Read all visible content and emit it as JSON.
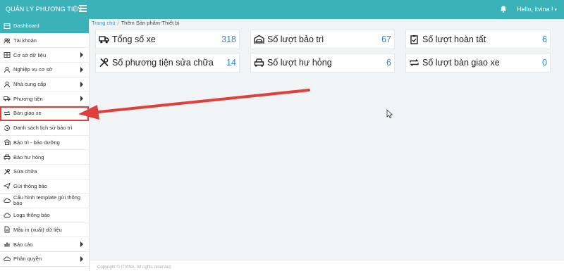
{
  "header": {
    "brand": "QUẢN LÝ PHƯƠNG TIỆN",
    "user_greeting": "Hello, itvina !",
    "caret": "▾",
    "icons": {
      "menu": "hamburger-icon",
      "notification": "bell-icon"
    }
  },
  "breadcrumb": {
    "home": "Trang chủ",
    "separator": "/",
    "current": "Thêm Sản phẩm-Thiết bị"
  },
  "sidebar": {
    "items": [
      {
        "label": "Dashboard",
        "icon": "dashboard-icon",
        "active": true,
        "has_submenu": false
      },
      {
        "label": "Tài khoản",
        "icon": "users-icon",
        "has_submenu": false
      },
      {
        "label": "Cơ sở dữ liệu",
        "icon": "table-icon",
        "has_submenu": true
      },
      {
        "label": "Nghiệp vụ cơ sở",
        "icon": "user-icon",
        "has_submenu": true
      },
      {
        "label": "Nhà cung cấp",
        "icon": "user-icon",
        "has_submenu": true
      },
      {
        "label": "Phương tiện",
        "icon": "truck-icon",
        "has_submenu": true
      },
      {
        "label": "Bàn giao xe",
        "icon": "exchange-icon",
        "has_submenu": false,
        "highlighted": true
      },
      {
        "label": "Danh sách lịch sử bảo trì",
        "icon": "history-icon",
        "has_submenu": false
      },
      {
        "label": "Bảo trì - bảo dưỡng",
        "icon": "garage-icon",
        "has_submenu": false
      },
      {
        "label": "Báo hư hỏng",
        "icon": "car-front-icon",
        "has_submenu": false
      },
      {
        "label": "Sửa chữa",
        "icon": "tools-icon",
        "has_submenu": false
      },
      {
        "label": "Gửi thông báo",
        "icon": "paper-plane-icon",
        "has_submenu": false
      },
      {
        "label": "Cấu hình template gửi thông báo",
        "icon": "cloud-icon",
        "has_submenu": false
      },
      {
        "label": "Logs thông báo",
        "icon": "cloud-icon",
        "has_submenu": false
      },
      {
        "label": "Mẫu in (xuất) dữ liệu",
        "icon": "document-icon",
        "has_submenu": false
      },
      {
        "label": "Báo cáo",
        "icon": "chart-icon",
        "has_submenu": true
      },
      {
        "label": "Phân quyền",
        "icon": "cloud-icon",
        "has_submenu": true
      }
    ]
  },
  "cards": [
    {
      "label": "Tổng số xe",
      "value": "318",
      "icon": "truck-icon"
    },
    {
      "label": "Số lượt bảo trì",
      "value": "67",
      "icon": "garage-icon"
    },
    {
      "label": "Số lượt hoàn tất",
      "value": "6",
      "icon": "clipboard-check-icon"
    },
    {
      "label": "Số phương tiện sửa chữa",
      "value": "14",
      "icon": "tools-icon"
    },
    {
      "label": "Số lượt hư hỏng",
      "value": "6",
      "icon": "car-front-icon"
    },
    {
      "label": "Số lượt bàn giao xe",
      "value": "0",
      "icon": "exchange-icon"
    }
  ],
  "footer": {
    "text": "Copyright © ITVINA. All rights reserved."
  },
  "colors": {
    "header": "#3bb2b8",
    "accent_value": "#2f86c9",
    "annotation": "#e0403c"
  }
}
